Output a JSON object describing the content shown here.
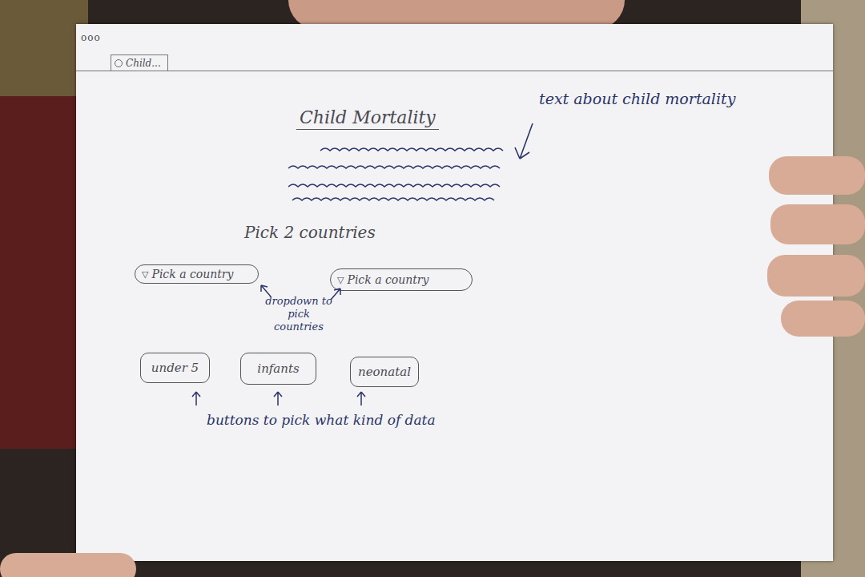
{
  "browser": {
    "dots": "ooo",
    "tab": "Child..."
  },
  "page": {
    "title": "Child Mortality",
    "prompt": "Pick 2 countries",
    "dropdowns": [
      {
        "icon": "▽",
        "label": "Pick a country"
      },
      {
        "icon": "▽",
        "label": "Pick a country"
      }
    ],
    "buttons": [
      "under 5",
      "infants",
      "neonatal"
    ]
  },
  "annotations": [
    "text about child mortality",
    "dropdown to pick countries",
    "buttons to pick what kind of data"
  ]
}
